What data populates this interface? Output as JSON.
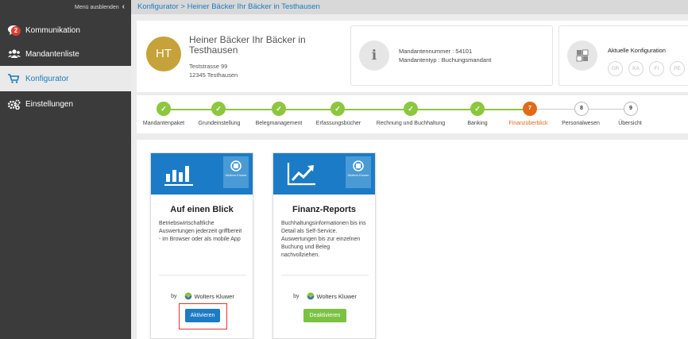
{
  "sidebar": {
    "hide_label": "Menü ausblenden",
    "items": [
      {
        "label": "Kommunikation",
        "icon": "chat-icon",
        "badge": "2"
      },
      {
        "label": "Mandantenliste",
        "icon": "users-icon"
      },
      {
        "label": "Konfigurator",
        "icon": "cart-icon",
        "active": true
      },
      {
        "label": "Einstellungen",
        "icon": "gear-icon"
      }
    ]
  },
  "breadcrumb": "Konfigurator > Heiner Bäcker Ihr Bäcker in Testhausen",
  "client": {
    "initials": "HT",
    "name": "Heiner Bäcker Ihr Bäcker in Testhausen",
    "street": "Teststrasse 99",
    "city": "12345 Testhausen",
    "number_line": "Mandantennummer :  54101",
    "type_line": "Mandantentyp :  Buchungsmandant"
  },
  "config": {
    "title": "Aktuelle Konfiguration",
    "tags": [
      "GR",
      "KA",
      "FI",
      "PE"
    ]
  },
  "steps": [
    {
      "label": "Mandantenpaket",
      "state": "done"
    },
    {
      "label": "Grundeinstellung",
      "state": "done"
    },
    {
      "label": "Belegmanagement",
      "state": "done"
    },
    {
      "label": "Erfassungsbücher",
      "state": "done"
    },
    {
      "label": "Rechnung und Buchhaltung",
      "state": "done"
    },
    {
      "label": "Banking",
      "state": "done"
    },
    {
      "label": "Finanzüberblick",
      "state": "current",
      "num": "7"
    },
    {
      "label": "Personalwesen",
      "state": "todo",
      "num": "8"
    },
    {
      "label": "Übersicht",
      "state": "todo",
      "num": "9"
    }
  ],
  "tiles": [
    {
      "title": "Auf einen Blick",
      "desc": "Betriebswirtschaftliche Auswertungen jederzeit griffbereit - im Browser oder als mobile App",
      "by": "by",
      "brand": "Wolters Kluwer",
      "brand_badge": "Wolters Kluwer",
      "button": "Aktivieren"
    },
    {
      "title": "Finanz-Reports",
      "desc": "Buchhaltungsinformationen bis ins Detail als Self-Service. Auswertungen bis zur einzelnen Buchung und Beleg nachvollziehen.",
      "by": "by",
      "brand": "Wolters Kluwer",
      "brand_badge": "Wolters Kluwer",
      "button": "Deaktivieren"
    }
  ],
  "colors": {
    "sidebar_bg": "#3b3b3b",
    "accent_blue": "#1c7bc6",
    "step_done": "#8dc63f",
    "step_current": "#e06b1b",
    "avatar": "#c5a23a"
  }
}
